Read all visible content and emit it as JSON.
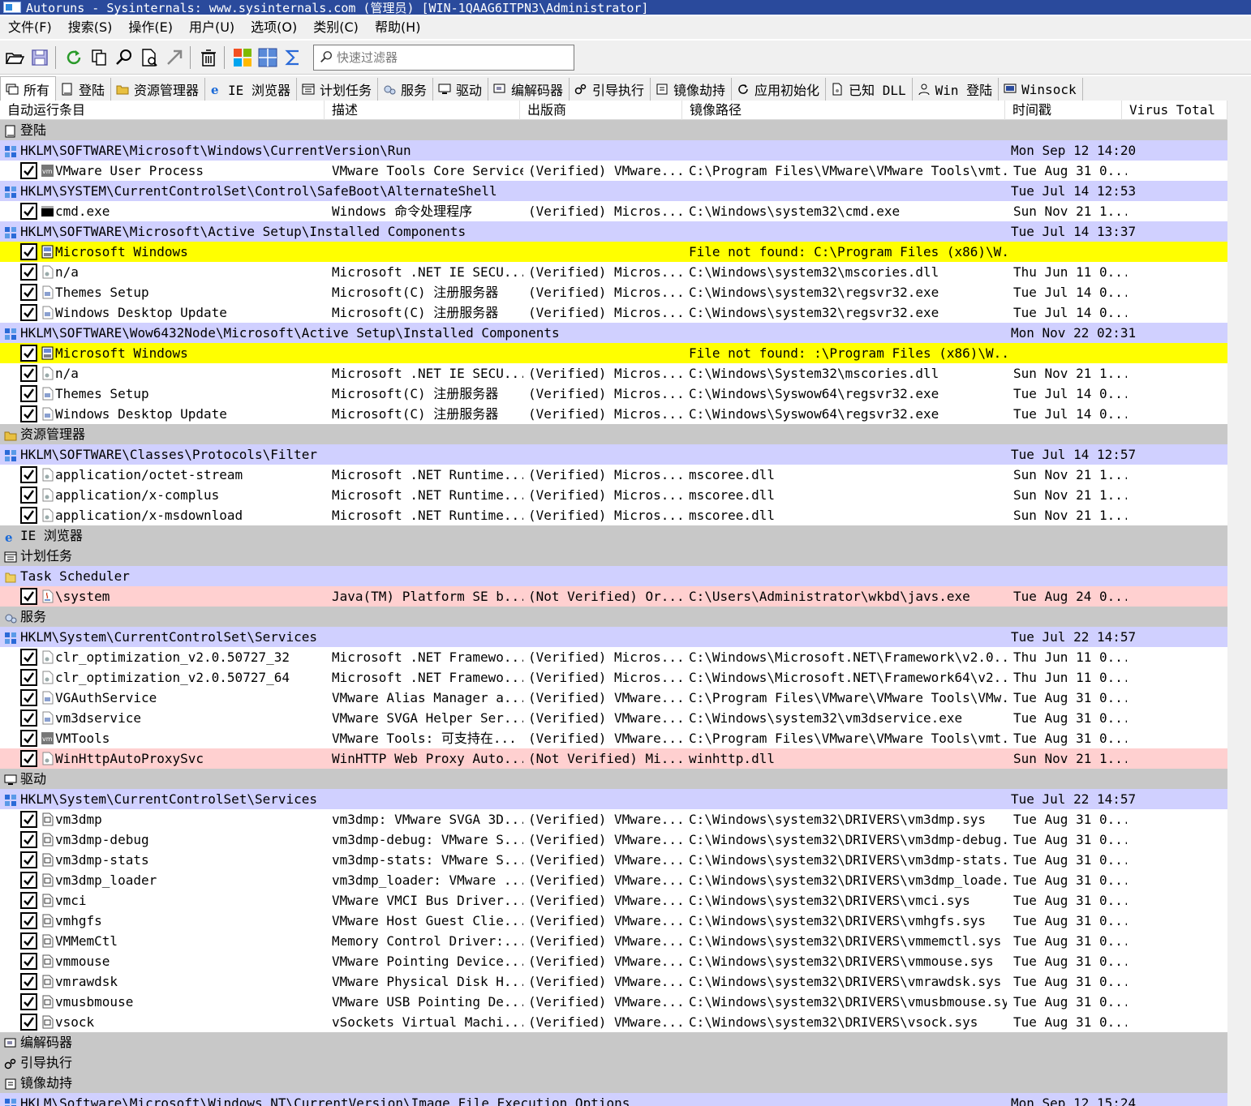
{
  "window": {
    "title": "Autoruns - Sysinternals: www.sysinternals.com (管理员) [WIN-1QAAG6ITPN3\\Administrator]"
  },
  "menu": [
    "文件(F)",
    "搜索(S)",
    "操作(E)",
    "用户(U)",
    "选项(O)",
    "类别(C)",
    "帮助(H)"
  ],
  "toolbar": {
    "buttons": [
      "open-icon",
      "save-icon",
      "refresh-icon",
      "copy-icon",
      "find-icon",
      "online-search-icon",
      "jump-icon",
      "delete-icon",
      "windows-entries-icon",
      "grid-icon",
      "sigma-icon"
    ],
    "filter_placeholder": "快速过滤器"
  },
  "tabs": [
    {
      "label": "所有",
      "icon": "all-icon",
      "active": true
    },
    {
      "label": "登陆",
      "icon": "logon-icon"
    },
    {
      "label": "资源管理器",
      "icon": "explorer-icon"
    },
    {
      "label": "IE 浏览器",
      "icon": "ie-icon"
    },
    {
      "label": "计划任务",
      "icon": "scheduled-task-icon"
    },
    {
      "label": "服务",
      "icon": "services-icon"
    },
    {
      "label": "驱动",
      "icon": "drivers-icon"
    },
    {
      "label": "编解码器",
      "icon": "codecs-icon"
    },
    {
      "label": "引导执行",
      "icon": "boot-execute-icon"
    },
    {
      "label": "镜像劫持",
      "icon": "image-hijacks-icon"
    },
    {
      "label": "应用初始化",
      "icon": "appinit-icon"
    },
    {
      "label": "已知 DLL",
      "icon": "known-dll-icon"
    },
    {
      "label": "Win 登陆",
      "icon": "winlogon-icon"
    },
    {
      "label": "Winsock",
      "icon": "winsock-icon"
    }
  ],
  "columns": [
    "自动运行条目",
    "描述",
    "出版商",
    "镜像路径",
    "时间戳",
    "Virus Total"
  ],
  "rows": [
    {
      "type": "cat",
      "icon": "logon-icon",
      "label": "登陆"
    },
    {
      "type": "key",
      "label": "HKLM\\SOFTWARE\\Microsoft\\Windows\\CurrentVersion\\Run",
      "time": "Mon Sep 12 14:20"
    },
    {
      "type": "entry",
      "icon": "vm-icon",
      "entry": "VMware User Process",
      "desc": "VMware Tools Core Service",
      "pub": "(Verified) VMware...",
      "path": "C:\\Program Files\\VMware\\VMware Tools\\vmt...",
      "time": "Tue Aug 31 0..."
    },
    {
      "type": "key",
      "label": "HKLM\\SYSTEM\\CurrentControlSet\\Control\\SafeBoot\\AlternateShell",
      "time": "Tue Jul 14 12:53"
    },
    {
      "type": "entry",
      "icon": "cmd-icon",
      "entry": "cmd.exe",
      "desc": "Windows 命令处理程序",
      "pub": "(Verified) Micros...",
      "path": "C:\\Windows\\system32\\cmd.exe",
      "time": "Sun Nov 21 1..."
    },
    {
      "type": "key",
      "label": "HKLM\\SOFTWARE\\Microsoft\\Active Setup\\Installed Components",
      "time": "Tue Jul 14 13:37"
    },
    {
      "type": "entry",
      "hl": true,
      "icon": "window-icon",
      "entry": "Microsoft Windows",
      "notfound": "File not found: C:\\Program Files (x86)\\W..."
    },
    {
      "type": "entry",
      "icon": "dll-icon",
      "entry": "n/a",
      "desc": "Microsoft .NET IE SECU...",
      "pub": "(Verified) Micros...",
      "path": "C:\\Windows\\system32\\mscories.dll",
      "time": "Thu Jun 11 0..."
    },
    {
      "type": "entry",
      "icon": "exe-icon",
      "entry": "Themes Setup",
      "desc": "Microsoft(C) 注册服务器",
      "pub": "(Verified) Micros...",
      "path": "C:\\Windows\\system32\\regsvr32.exe",
      "time": "Tue Jul 14 0..."
    },
    {
      "type": "entry",
      "icon": "exe-icon",
      "entry": "Windows Desktop Update",
      "desc": "Microsoft(C) 注册服务器",
      "pub": "(Verified) Micros...",
      "path": "C:\\Windows\\system32\\regsvr32.exe",
      "time": "Tue Jul 14 0..."
    },
    {
      "type": "key",
      "label": "HKLM\\SOFTWARE\\Wow6432Node\\Microsoft\\Active Setup\\Installed Components",
      "time": "Mon Nov 22 02:31"
    },
    {
      "type": "entry",
      "hl": true,
      "icon": "window-icon",
      "entry": "Microsoft Windows",
      "notfound": "File not found: :\\Program Files (x86)\\W..."
    },
    {
      "type": "entry",
      "icon": "dll-icon",
      "entry": "n/a",
      "desc": "Microsoft .NET IE SECU...",
      "pub": "(Verified) Micros...",
      "path": "C:\\Windows\\System32\\mscories.dll",
      "time": "Sun Nov 21 1..."
    },
    {
      "type": "entry",
      "icon": "exe-icon",
      "entry": "Themes Setup",
      "desc": "Microsoft(C) 注册服务器",
      "pub": "(Verified) Micros...",
      "path": "C:\\Windows\\Syswow64\\regsvr32.exe",
      "time": "Tue Jul 14 0..."
    },
    {
      "type": "entry",
      "icon": "exe-icon",
      "entry": "Windows Desktop Update",
      "desc": "Microsoft(C) 注册服务器",
      "pub": "(Verified) Micros...",
      "path": "C:\\Windows\\Syswow64\\regsvr32.exe",
      "time": "Tue Jul 14 0..."
    },
    {
      "type": "cat",
      "icon": "explorer-icon",
      "label": "资源管理器"
    },
    {
      "type": "key",
      "label": "HKLM\\SOFTWARE\\Classes\\Protocols\\Filter",
      "time": "Tue Jul 14 12:57"
    },
    {
      "type": "entry",
      "icon": "dll-icon",
      "entry": "application/octet-stream",
      "desc": "Microsoft .NET Runtime...",
      "pub": "(Verified) Micros...",
      "path": "mscoree.dll",
      "time": "Sun Nov 21 1..."
    },
    {
      "type": "entry",
      "icon": "dll-icon",
      "entry": "application/x-complus",
      "desc": "Microsoft .NET Runtime...",
      "pub": "(Verified) Micros...",
      "path": "mscoree.dll",
      "time": "Sun Nov 21 1..."
    },
    {
      "type": "entry",
      "icon": "dll-icon",
      "entry": "application/x-msdownload",
      "desc": "Microsoft .NET Runtime...",
      "pub": "(Verified) Micros...",
      "path": "mscoree.dll",
      "time": "Sun Nov 21 1..."
    },
    {
      "type": "cat",
      "icon": "ie-icon",
      "label": "IE 浏览器"
    },
    {
      "type": "cat",
      "icon": "scheduled-task-icon",
      "label": "计划任务"
    },
    {
      "type": "folder",
      "icon": "folder-icon",
      "label": "Task Scheduler"
    },
    {
      "type": "entry",
      "nv": true,
      "icon": "java-icon",
      "entry": "\\system",
      "desc": "Java(TM) Platform SE b...",
      "pub": "(Not Verified) Or...",
      "path": "C:\\Users\\Administrator\\wkbd\\javs.exe",
      "time": "Tue Aug 24 0..."
    },
    {
      "type": "cat",
      "icon": "services-icon",
      "label": "服务"
    },
    {
      "type": "key",
      "label": "HKLM\\System\\CurrentControlSet\\Services",
      "time": "Tue Jul 22 14:57"
    },
    {
      "type": "entry",
      "icon": "dll-icon",
      "entry": "clr_optimization_v2.0.50727_32",
      "desc": "Microsoft .NET Framewo...",
      "pub": "(Verified) Micros...",
      "path": "C:\\Windows\\Microsoft.NET\\Framework\\v2.0....",
      "time": "Thu Jun 11 0..."
    },
    {
      "type": "entry",
      "icon": "dll-icon",
      "entry": "clr_optimization_v2.0.50727_64",
      "desc": "Microsoft .NET Framewo...",
      "pub": "(Verified) Micros...",
      "path": "C:\\Windows\\Microsoft.NET\\Framework64\\v2....",
      "time": "Thu Jun 11 0..."
    },
    {
      "type": "entry",
      "icon": "exe-icon",
      "entry": "VGAuthService",
      "desc": "VMware Alias Manager a...",
      "pub": "(Verified) VMware...",
      "path": "C:\\Program Files\\VMware\\VMware Tools\\VMw...",
      "time": "Tue Aug 31 0..."
    },
    {
      "type": "entry",
      "icon": "exe-icon",
      "entry": "vm3dservice",
      "desc": "VMware SVGA Helper Ser...",
      "pub": "(Verified) VMware...",
      "path": "C:\\Windows\\system32\\vm3dservice.exe",
      "time": "Tue Aug 31 0..."
    },
    {
      "type": "entry",
      "icon": "vm-icon",
      "entry": "VMTools",
      "desc": "VMware Tools: 可支持在...",
      "pub": "(Verified) VMware...",
      "path": "C:\\Program Files\\VMware\\VMware Tools\\vmt...",
      "time": "Tue Aug 31 0..."
    },
    {
      "type": "entry",
      "nv": true,
      "icon": "dll-icon",
      "entry": "WinHttpAutoProxySvc",
      "desc": "WinHTTP Web Proxy Auto...",
      "pub": "(Not Verified) Mi...",
      "path": "winhttp.dll",
      "time": "Sun Nov 21 1..."
    },
    {
      "type": "cat",
      "icon": "drivers-icon",
      "label": "驱动"
    },
    {
      "type": "key",
      "label": "HKLM\\System\\CurrentControlSet\\Services",
      "time": "Tue Jul 22 14:57"
    },
    {
      "type": "entry",
      "icon": "sys-icon",
      "entry": "vm3dmp",
      "desc": "vm3dmp: VMware SVGA 3D...",
      "pub": "(Verified) VMware...",
      "path": "C:\\Windows\\system32\\DRIVERS\\vm3dmp.sys",
      "time": "Tue Aug 31 0..."
    },
    {
      "type": "entry",
      "icon": "sys-icon",
      "entry": "vm3dmp-debug",
      "desc": "vm3dmp-debug: VMware S...",
      "pub": "(Verified) VMware...",
      "path": "C:\\Windows\\system32\\DRIVERS\\vm3dmp-debug...",
      "time": "Tue Aug 31 0..."
    },
    {
      "type": "entry",
      "icon": "sys-icon",
      "entry": "vm3dmp-stats",
      "desc": "vm3dmp-stats: VMware S...",
      "pub": "(Verified) VMware...",
      "path": "C:\\Windows\\system32\\DRIVERS\\vm3dmp-stats...",
      "time": "Tue Aug 31 0..."
    },
    {
      "type": "entry",
      "icon": "sys-icon",
      "entry": "vm3dmp_loader",
      "desc": "vm3dmp_loader: VMware ...",
      "pub": "(Verified) VMware...",
      "path": "C:\\Windows\\system32\\DRIVERS\\vm3dmp_loade...",
      "time": "Tue Aug 31 0..."
    },
    {
      "type": "entry",
      "icon": "sys-icon",
      "entry": "vmci",
      "desc": "VMware VMCI Bus Driver...",
      "pub": "(Verified) VMware...",
      "path": "C:\\Windows\\system32\\DRIVERS\\vmci.sys",
      "time": "Tue Aug 31 0..."
    },
    {
      "type": "entry",
      "icon": "sys-icon",
      "entry": "vmhgfs",
      "desc": "VMware Host Guest Clie...",
      "pub": "(Verified) VMware...",
      "path": "C:\\Windows\\system32\\DRIVERS\\vmhgfs.sys",
      "time": "Tue Aug 31 0..."
    },
    {
      "type": "entry",
      "icon": "sys-icon",
      "entry": "VMMemCtl",
      "desc": "Memory Control Driver:...",
      "pub": "(Verified) VMware...",
      "path": "C:\\Windows\\system32\\DRIVERS\\vmmemctl.sys",
      "time": "Tue Aug 31 0..."
    },
    {
      "type": "entry",
      "icon": "sys-icon",
      "entry": "vmmouse",
      "desc": "VMware Pointing Device...",
      "pub": "(Verified) VMware...",
      "path": "C:\\Windows\\system32\\DRIVERS\\vmmouse.sys",
      "time": "Tue Aug 31 0..."
    },
    {
      "type": "entry",
      "icon": "sys-icon",
      "entry": "vmrawdsk",
      "desc": "VMware Physical Disk H...",
      "pub": "(Verified) VMware...",
      "path": "C:\\Windows\\system32\\DRIVERS\\vmrawdsk.sys",
      "time": "Tue Aug 31 0..."
    },
    {
      "type": "entry",
      "icon": "sys-icon",
      "entry": "vmusbmouse",
      "desc": "VMware USB Pointing De...",
      "pub": "(Verified) VMware...",
      "path": "C:\\Windows\\system32\\DRIVERS\\vmusbmouse.sys",
      "time": "Tue Aug 31 0..."
    },
    {
      "type": "entry",
      "icon": "sys-icon",
      "entry": "vsock",
      "desc": "vSockets Virtual Machi...",
      "pub": "(Verified) VMware...",
      "path": "C:\\Windows\\system32\\DRIVERS\\vsock.sys",
      "time": "Tue Aug 31 0..."
    },
    {
      "type": "cat",
      "icon": "codecs-icon",
      "label": "编解码器"
    },
    {
      "type": "cat",
      "icon": "boot-execute-icon",
      "label": "引导执行"
    },
    {
      "type": "cat",
      "icon": "image-hijacks-icon",
      "label": "镜像劫持"
    },
    {
      "type": "key",
      "label": "HKLM\\Software\\Microsoft\\Windows NT\\CurrentVersion\\Image File Execution Options",
      "time": "Mon Sep 12 15:24"
    }
  ]
}
